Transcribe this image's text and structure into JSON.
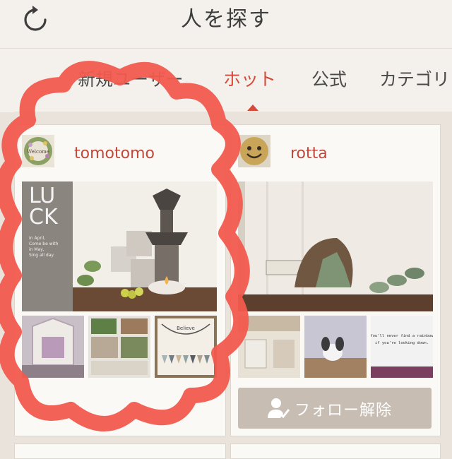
{
  "header": {
    "title": "人を探す",
    "refresh_icon": "refresh-icon"
  },
  "tabs": [
    {
      "label": "新規ユーザー",
      "active": false
    },
    {
      "label": "ホット",
      "active": true
    },
    {
      "label": "公式",
      "active": false
    },
    {
      "label": "カテゴリ",
      "active": false
    }
  ],
  "cards": [
    {
      "username": "tomotomo",
      "avatar_text": "Welcome",
      "photo_text": {
        "big": "LU\nCK",
        "small": "In April,\nCome be with\nin May,\nSing all day."
      }
    },
    {
      "username": "rotta",
      "follow_label": "フォロー解除",
      "thumb_caption": "You'll never find a rainbow\nif you're looking down."
    }
  ],
  "colors": {
    "accent": "#d44b3b",
    "username": "#c2483a",
    "scribble": "#f25a4e",
    "button": "#c7bdb2"
  }
}
